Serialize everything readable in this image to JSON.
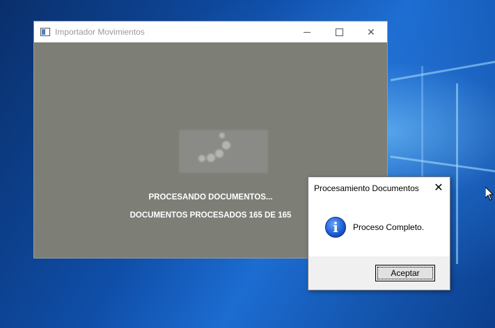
{
  "main_window": {
    "title": "Importador Movimientos",
    "controls": {
      "minimize": "minimize",
      "maximize": "maximize",
      "close": "✕"
    },
    "status_line_1": "PROCESANDO DOCUMENTOS...",
    "status_line_2": "DOCUMENTOS PROCESADOS 165 DE 165",
    "content_bg": "#7d7f76"
  },
  "dialog": {
    "title": "Procesamiento Documentos",
    "close": "✕",
    "icon": "info-icon",
    "icon_glyph": "i",
    "message": "Proceso Completo.",
    "ok_label": "Aceptar"
  },
  "desktop": {
    "wallpaper": "windows-10-hero",
    "accent": "#1c6cd1"
  }
}
